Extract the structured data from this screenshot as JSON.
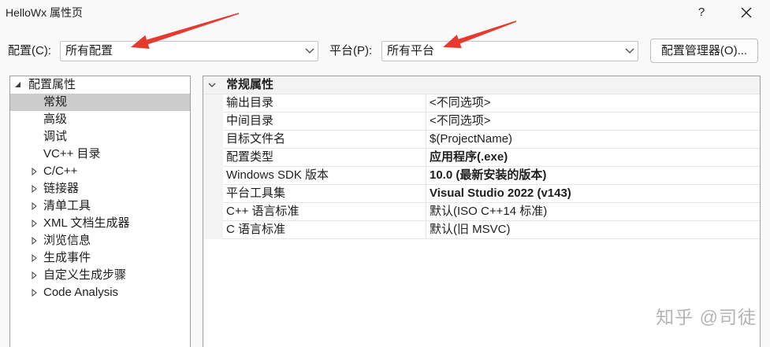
{
  "window": {
    "title": "HelloWx 属性页",
    "help_label": "?"
  },
  "toolbar": {
    "configuration_label": "配置(C):",
    "configuration_value": "所有配置",
    "platform_label": "平台(P):",
    "platform_value": "所有平台",
    "configuration_manager_label": "配置管理器(O)..."
  },
  "tree": {
    "root": {
      "label": "配置属性",
      "expanded": true
    },
    "children": [
      {
        "label": "常规",
        "selected": true,
        "expandable": false
      },
      {
        "label": "高级",
        "selected": false,
        "expandable": false
      },
      {
        "label": "调试",
        "selected": false,
        "expandable": false
      },
      {
        "label": "VC++ 目录",
        "selected": false,
        "expandable": false
      },
      {
        "label": "C/C++",
        "selected": false,
        "expandable": true
      },
      {
        "label": "链接器",
        "selected": false,
        "expandable": true
      },
      {
        "label": "清单工具",
        "selected": false,
        "expandable": true
      },
      {
        "label": "XML 文档生成器",
        "selected": false,
        "expandable": true
      },
      {
        "label": "浏览信息",
        "selected": false,
        "expandable": true
      },
      {
        "label": "生成事件",
        "selected": false,
        "expandable": true
      },
      {
        "label": "自定义生成步骤",
        "selected": false,
        "expandable": true
      },
      {
        "label": "Code Analysis",
        "selected": false,
        "expandable": true
      }
    ]
  },
  "properties": {
    "category": {
      "label": "常规属性",
      "expanded": true
    },
    "rows": [
      {
        "name": "输出目录",
        "value": "<不同选项>",
        "bold": false
      },
      {
        "name": "中间目录",
        "value": "<不同选项>",
        "bold": false
      },
      {
        "name": "目标文件名",
        "value": "$(ProjectName)",
        "bold": false
      },
      {
        "name": "配置类型",
        "value": "应用程序(.exe)",
        "bold": true
      },
      {
        "name": "Windows SDK 版本",
        "value": "10.0 (最新安装的版本)",
        "bold": true
      },
      {
        "name": "平台工具集",
        "value": "Visual Studio 2022 (v143)",
        "bold": true
      },
      {
        "name": "C++ 语言标准",
        "value": "默认(ISO C++14 标准)",
        "bold": false
      },
      {
        "name": "C 语言标准",
        "value": "默认(旧 MSVC)",
        "bold": false
      }
    ]
  },
  "watermark": "知乎 @司徒",
  "icons": {
    "help": "help-icon",
    "close": "close-icon",
    "dropdown": "chevron-down-icon",
    "tree_expanded": "expanded-triangle-icon",
    "tree_collapsed": "collapsed-triangle-icon",
    "category_expanded": "chevron-down-icon",
    "annotation": "red-arrow-icon"
  },
  "colors": {
    "window_bg": "#f9f9f9",
    "panel_bg": "#ffffff",
    "panel_border": "#a0a0a0",
    "input_border": "#c4c4c4",
    "selection_bg": "#cccccc",
    "grid_margin_bg": "#f3f3f3",
    "grid_line": "#e5e5e5",
    "text": "#1e1e1e",
    "watermark": "#b4b4b4",
    "annotation_arrow": "#e8392e"
  }
}
